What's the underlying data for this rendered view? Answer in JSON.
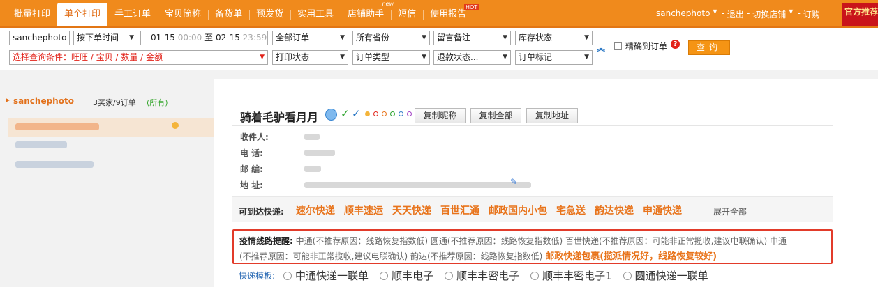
{
  "nav": {
    "tabs": [
      {
        "label": "批量打印",
        "active": false
      },
      {
        "label": "单个打印",
        "active": true
      },
      {
        "label": "手工订单",
        "active": false
      },
      {
        "label": "宝贝简称",
        "active": false
      },
      {
        "label": "备货单",
        "active": false
      },
      {
        "label": "预发货",
        "active": false
      },
      {
        "label": "实用工具",
        "active": false
      },
      {
        "label": "店铺助手",
        "badge": "new"
      },
      {
        "label": "短信",
        "active": false
      },
      {
        "label": "使用报告",
        "badge": "HOT"
      }
    ],
    "user": {
      "name": "sanchephoto",
      "logout": "退出",
      "switch_shop": "切换店铺",
      "subscribe": "订购",
      "sep": "-"
    },
    "official_badge": "官方推荐"
  },
  "filters": {
    "shop_select": "sanchephoto",
    "sort_select": "按下单时间",
    "date_from": "01-15",
    "time_from": "00:00",
    "date_to_word": "至",
    "date_to": "02-15",
    "time_to": "23:59",
    "order_scope": "全部订单",
    "province": "所有省份",
    "remark": "留言备注",
    "stock": "库存状态",
    "query_condition": "选择查询条件：旺旺 / 宝贝 / 数量 / 金额",
    "print_status": "打印状态",
    "order_type": "订单类型",
    "refund_status": "退款状态...",
    "order_flag": "订单标记",
    "exact_match_label": "精确到订单",
    "query_button": "查询"
  },
  "left": {
    "shop_name": "sanchephoto",
    "summary": "3买家/9订单",
    "all_label": "(所有)"
  },
  "detail": {
    "buyer_nick": "骑着毛驴看月月",
    "buttons": {
      "copy_nick": "复制昵称",
      "copy_all": "复制全部",
      "copy_address": "复制地址"
    },
    "fields": [
      {
        "label": "收件人:"
      },
      {
        "label": "电  话:"
      },
      {
        "label": "邮  编:"
      },
      {
        "label": "地  址:"
      }
    ],
    "express": {
      "label": "可到达快递:",
      "items": [
        "速尔快递",
        "顺丰速运",
        "天天快递",
        "百世汇通",
        "邮政国内小包",
        "宅急送",
        "韵达快递",
        "申通快递"
      ],
      "expand_all": "展开全部"
    },
    "notice": {
      "title": "疫情线路提醒:",
      "line1": "中通(不推荐原因：线路恢复指数低)   圆通(不推荐原因：线路恢复指数低)   百世快递(不推荐原因：可能非正常揽收,建议电联确认)   申通",
      "line2": "(不推荐原因：可能非正常揽收,建议电联确认)   韵达(不推荐原因：线路恢复指数低)",
      "highlight": "邮政快递包裹(揽派情况好，线路恢复较好)"
    },
    "templates": {
      "label": "快递模板:",
      "options": [
        "中通快递一联单",
        "顺丰电子",
        "顺丰丰密电子",
        "顺丰丰密电子1",
        "圆通快递一联单"
      ]
    }
  }
}
